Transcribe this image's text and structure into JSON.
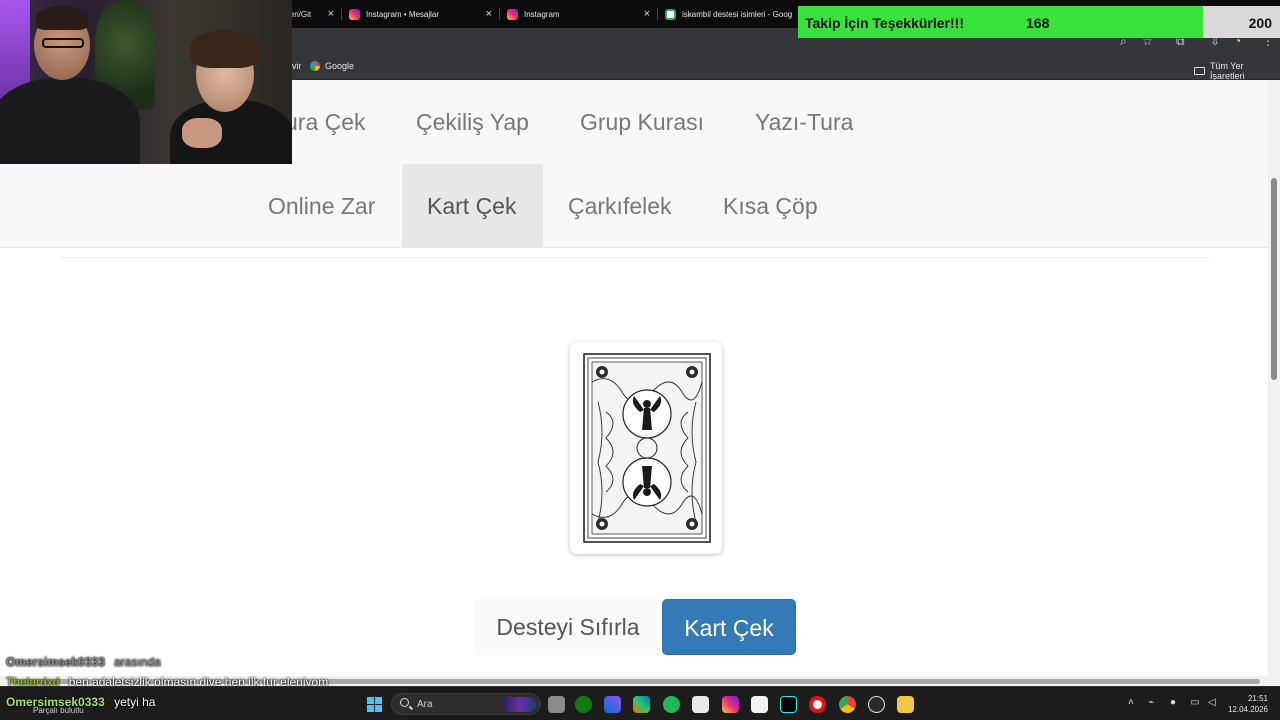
{
  "browser": {
    "tabs": [
      {
        "title": "len/Git",
        "icon": "github-icon"
      },
      {
        "title": "Instagram • Mesajlar",
        "icon": "instagram-icon"
      },
      {
        "title": "Instagram",
        "icon": "instagram-icon"
      },
      {
        "title": "iskambil destesi isimleri - Goog",
        "icon": "google-icon"
      }
    ],
    "bookmarks": [
      {
        "label": "vir"
      },
      {
        "label": "Google",
        "icon": "google-icon"
      }
    ],
    "all_bookmarks_label": "Tüm Yer İşaretleri"
  },
  "follow_goal": {
    "title": "Takip İçin Teşekkürler!!!",
    "current": "168",
    "target": "200",
    "progress": 0.84,
    "fill_color": "#39e23a"
  },
  "page": {
    "nav_row1": [
      "ura Çek",
      "Çekiliş Yap",
      "Grup Kurası",
      "Yazı-Tura"
    ],
    "nav_row2": [
      "Online Zar",
      "Kart Çek",
      "Çarkıfelek",
      "Kısa Çöp"
    ],
    "active_nav": "Kart Çek",
    "card_state": "card-back",
    "buttons": {
      "reset_label": "Desteyi Sıfırla",
      "draw_label": "Kart Çek"
    },
    "primary_color": "#337ab7"
  },
  "chat": [
    {
      "user": "Omersimsek0333",
      "message": "arasında",
      "user_color": "#8a8a8a",
      "message_color": "#8a8a8a"
    },
    {
      "user": "Thelardxd",
      "message": "ben adaletsizlik olmasın diye hep ilk tur eleniyom",
      "user_color": "#9acd32",
      "message_color": "#ffffff"
    },
    {
      "user": "Omersimsek0333",
      "message": "yetyi ha",
      "user_color": "#a8e063",
      "message_color": "#ffffff"
    }
  ],
  "taskbar": {
    "weather": "Parçalı bulutlu",
    "search_placeholder": "Ara",
    "time": "21:51",
    "date": "12.04.2026"
  }
}
